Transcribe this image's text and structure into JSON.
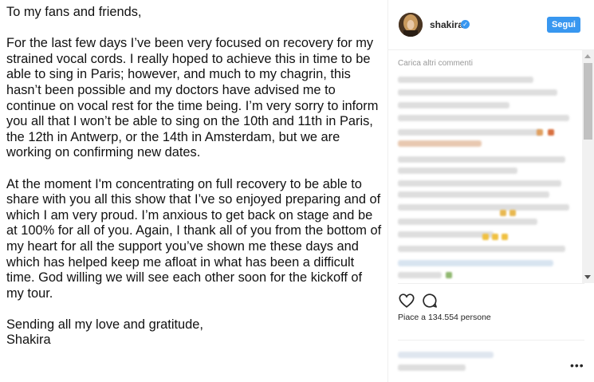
{
  "post": {
    "greeting": "To my fans and friends,",
    "paragraph1": "For the last few days I’ve been very focused on recovery for my strained vocal cords. I really hoped to achieve this in time to be able to sing in Paris; however, and much to my chagrin, this hasn’t been possible and my doctors have advised me to continue on vocal rest for the time being. I’m very sorry to inform you all that I won’t be able to sing on the 10th and 11th in Paris, the 12th in Antwerp, or the 14th in Amsterdam, but we are working on confirming new dates.",
    "paragraph2": "At the moment I'm concentrating on full recovery to be able to share with you all this show that I’ve so enjoyed preparing and of which I am very proud. I’m anxious to get back on stage and be at 100% for all of you. Again, I thank all of you from the bottom of my heart for all the support you’ve shown me these days and which has helped keep me afloat in what has been a difficult time. God willing we will see each other soon for the kickoff of my tour.",
    "closing": "Sending all my love and gratitude,",
    "signature": "Shakira"
  },
  "header": {
    "username": "shakira",
    "follow_label": "Segui",
    "verified_icon": "verified-badge-icon"
  },
  "comments": {
    "load_more": "Carica altri commenti"
  },
  "actions": {
    "like_icon": "heart-icon",
    "comment_icon": "comment-bubble-icon"
  },
  "likes_text": "Piace a 134.554 persone",
  "more_icon": "ellipsis-icon",
  "colors": {
    "accent": "#3897f0",
    "text": "#262626",
    "muted": "#999999",
    "divider": "#efefef"
  }
}
